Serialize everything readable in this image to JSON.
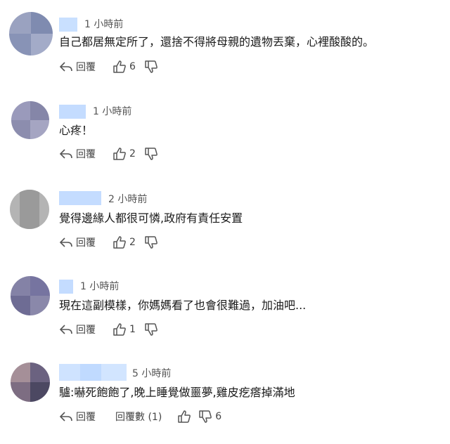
{
  "comments": [
    {
      "time": "1 小時前",
      "text": "自己都居無定所了，還捨不得將母親的遺物丟棄，心裡酸酸的。",
      "reply_label": "回覆",
      "likes": "6",
      "avatar_colors": [
        "#8a96b8",
        "#a3a9c6",
        "#6f7ea6",
        "#9aa4c4"
      ]
    },
    {
      "time": "1 小時前",
      "text": "心疼！",
      "reply_label": "回覆",
      "likes": "2",
      "avatar_colors": [
        "#8e8fb0",
        "#a09fbf",
        "#7a7b9e",
        "#9394b3"
      ]
    },
    {
      "time": "2 小時前",
      "text": "覺得邊緣人都很可憐,政府有責任安置",
      "reply_label": "回覆",
      "likes": "2",
      "avatar_colors": [
        "#a6a6a6",
        "#bcbcbc",
        "#8f8f8f",
        "#b0b0b0"
      ]
    },
    {
      "time": "1 小時前",
      "text": "現在這副模樣，你媽媽看了也會很難過，加油吧...",
      "reply_label": "回覆",
      "likes": "1",
      "avatar_colors": [
        "#7a78a0",
        "#8e8cb2",
        "#66648c",
        "#85839f"
      ]
    },
    {
      "time": "5 小時前",
      "text": "驢:嚇死飽飽了,晚上睡覺做噩夢,雞皮疙瘩掉滿地",
      "reply_label": "回覆",
      "reply_count_label": "回覆數 (1)",
      "likes": "",
      "dislikes": "6",
      "avatar_colors": [
        "#a08a92",
        "#4e4a64",
        "#7b6a80",
        "#5d5570"
      ]
    }
  ],
  "colors": {
    "name_block": "#c4dcff",
    "name_block_alt": "#d6e6ff"
  }
}
